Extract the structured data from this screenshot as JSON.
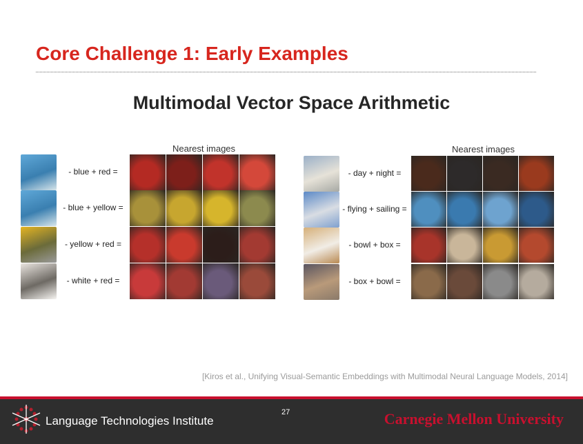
{
  "slide": {
    "title": "Core Challenge 1: Early Examples",
    "subtitle": "Multimodal Vector Space Arithmetic",
    "citation": "[Kiros et al., Unifying Visual-Semantic Embeddings with Multimodal Neural Language Models, 2014]",
    "page_number": "27"
  },
  "left_panel": {
    "header": "Nearest images",
    "rows": [
      {
        "operation": "- blue + red =",
        "query_colors": [
          "#5fa8d8",
          "#3a7fb0",
          "#d7e5ea"
        ],
        "result_colors": [
          "#b42a23",
          "#7d1f1a",
          "#c1332b",
          "#d4483a"
        ]
      },
      {
        "operation": "- blue + yellow =",
        "query_colors": [
          "#5fa8d8",
          "#3a7fb0",
          "#d7e5ea"
        ],
        "result_colors": [
          "#a8913a",
          "#c7a62f",
          "#d6b52c",
          "#8c8a4e"
        ]
      },
      {
        "operation": "- yellow + red =",
        "query_colors": [
          "#e4b422",
          "#6b6b3a",
          "#9a9a9a"
        ],
        "result_colors": [
          "#b5302a",
          "#c93a2d",
          "#2c1d1a",
          "#a33a32"
        ]
      },
      {
        "operation": "- white + red =",
        "query_colors": [
          "#e9e4df",
          "#6e6a64",
          "#f6f4f1"
        ],
        "result_colors": [
          "#c83a3a",
          "#a23a33",
          "#6a5a7a",
          "#9a4a3a"
        ]
      }
    ]
  },
  "right_panel": {
    "header": "Nearest images",
    "rows": [
      {
        "operation": "- day + night =",
        "query_colors": [
          "#9bb0c8",
          "#e6e2d8",
          "#a7a9a4"
        ],
        "result_colors": [
          "#4a2a1c",
          "#2d2a2a",
          "#3a2a22",
          "#9a3a1e"
        ]
      },
      {
        "operation": "- flying + sailing =",
        "query_colors": [
          "#5c8ac7",
          "#d9dde3",
          "#7fa0cf"
        ],
        "result_colors": [
          "#4f8fbf",
          "#3a7aaf",
          "#6ea3cf",
          "#2d5a8a"
        ]
      },
      {
        "operation": "- bowl + box =",
        "query_colors": [
          "#d6b07a",
          "#f1ede6",
          "#b98a52"
        ],
        "result_colors": [
          "#a8342a",
          "#c9b69a",
          "#c99a33",
          "#b4492e"
        ]
      },
      {
        "operation": "- box + bowl =",
        "query_colors": [
          "#5a5560",
          "#b99a7a",
          "#8a7a6a"
        ],
        "result_colors": [
          "#8a6a4a",
          "#6a4a3a",
          "#8a8a8a",
          "#b5ab9e"
        ]
      }
    ]
  },
  "footer": {
    "institute": "Language Technologies Institute",
    "university": "Carnegie Mellon University"
  },
  "colors": {
    "title_red": "#d7261e",
    "footer_bg": "#2e2e2e",
    "cmu_red": "#c8102e"
  }
}
